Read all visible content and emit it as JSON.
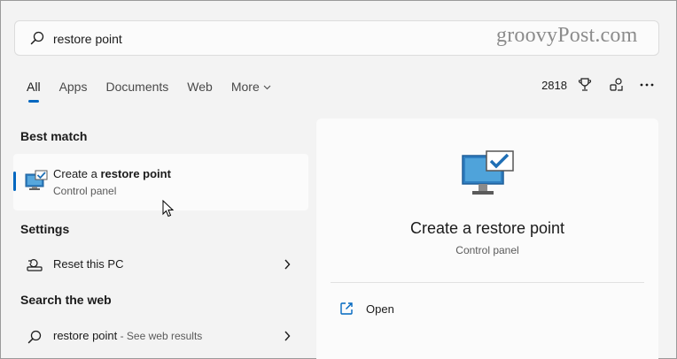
{
  "search": {
    "value": "restore point",
    "placeholder": ""
  },
  "watermark": "groovyPost.com",
  "tabs": [
    {
      "label": "All"
    },
    {
      "label": "Apps"
    },
    {
      "label": "Documents"
    },
    {
      "label": "Web"
    },
    {
      "label": "More"
    }
  ],
  "rewards": {
    "points": "2818"
  },
  "sections": {
    "best_match": "Best match",
    "settings": "Settings",
    "web": "Search the web"
  },
  "best_match": {
    "title_pre": "Create a ",
    "title_bold": "restore point",
    "subtitle": "Control panel"
  },
  "settings_items": [
    {
      "label": "Reset this PC"
    }
  ],
  "web_items": [
    {
      "label": "restore point",
      "suffix": " - See web results"
    }
  ],
  "preview": {
    "title": "Create a restore point",
    "subtitle": "Control panel",
    "actions": [
      {
        "label": "Open"
      }
    ]
  },
  "colors": {
    "accent": "#0067c0",
    "background": "#f3f3f3",
    "panel": "#fbfbfb"
  },
  "icons": {
    "search": "search-icon",
    "trophy": "trophy-icon",
    "share": "share-icon",
    "more": "more-icon",
    "restore": "restore-point-icon",
    "reset": "reset-pc-icon",
    "open": "open-external-icon"
  }
}
